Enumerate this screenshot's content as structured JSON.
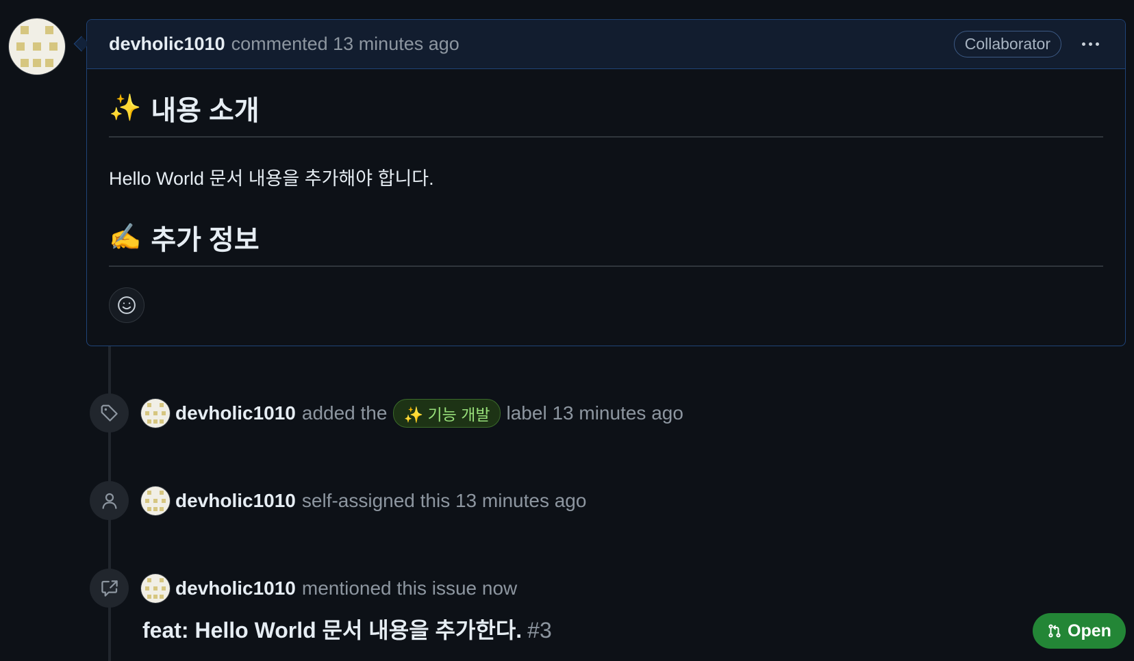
{
  "comment": {
    "author": "devholic1010",
    "meta": "commented 13 minutes ago",
    "badge": "Collaborator",
    "heading1_emoji": "✨",
    "heading1": "내용 소개",
    "paragraph": "Hello World 문서 내용을 추가해야 합니다.",
    "heading2_emoji": "✍️",
    "heading2": "추가 정보"
  },
  "timeline": [
    {
      "icon": "tag-icon",
      "author": "devholic1010",
      "before": "added the",
      "label": "✨ 기능 개발",
      "after": "label 13 minutes ago"
    },
    {
      "icon": "person-icon",
      "author": "devholic1010",
      "text": "self-assigned this 13 minutes ago"
    },
    {
      "icon": "cross-reference-icon",
      "author": "devholic1010",
      "text": "mentioned this issue now"
    }
  ],
  "reference": {
    "title": "feat: Hello World 문서 내용을 추가한다.",
    "number": "#3",
    "status": "Open"
  },
  "colors": {
    "background": "#0d1117",
    "comment_border": "#1f4479",
    "label_green": "#98e07a",
    "open_green": "#238636"
  }
}
